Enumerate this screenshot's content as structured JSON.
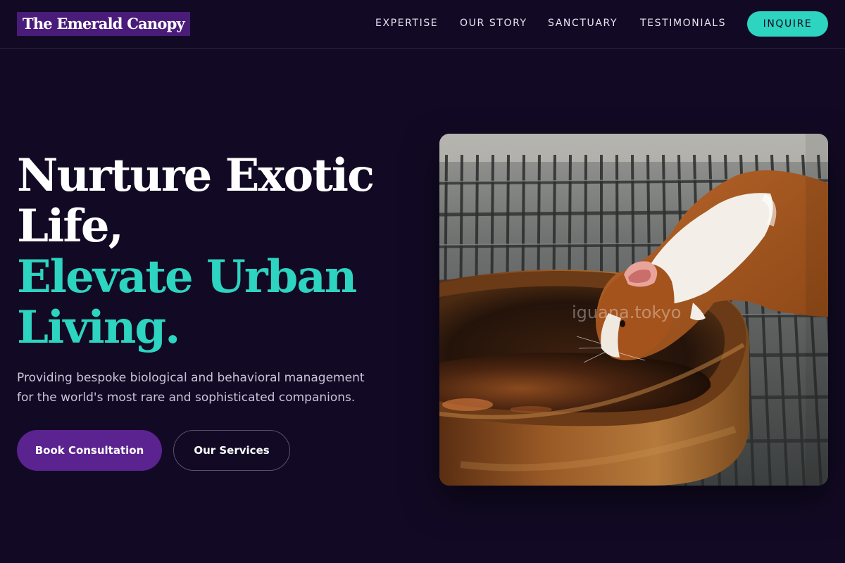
{
  "brand": {
    "name": "The Emerald Canopy"
  },
  "nav": {
    "links": [
      {
        "label": "EXPERTISE"
      },
      {
        "label": "OUR STORY"
      },
      {
        "label": "SANCTUARY"
      },
      {
        "label": "TESTIMONIALS"
      }
    ],
    "cta_label": "INQUIRE"
  },
  "hero": {
    "title_line1": "Nurture Exotic",
    "title_line2": "Life,",
    "title_line3": "Elevate Urban",
    "title_line4": "Living.",
    "subtitle": "Providing bespoke biological and behavioral management for the world's most rare and sophisticated companions.",
    "primary_button": "Book Consultation",
    "secondary_button": "Our Services",
    "image_watermark": "iguana.tokyo"
  },
  "colors": {
    "background": "#120a24",
    "accent": "#2dd4bf",
    "brand_purple": "#5b2390",
    "logo_bg": "#4a1c7a"
  }
}
